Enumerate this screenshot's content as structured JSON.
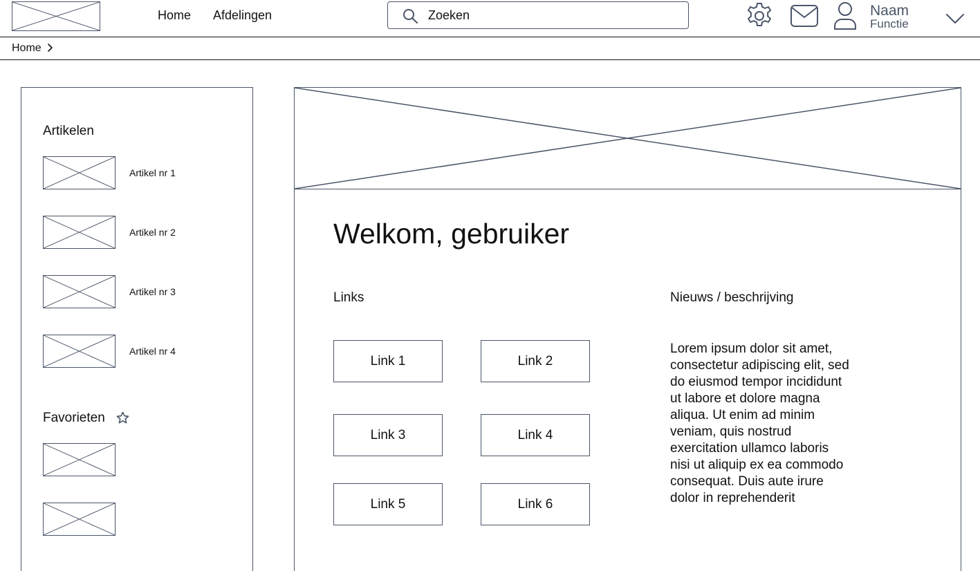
{
  "nav": {
    "home": "Home",
    "departments": "Afdelingen"
  },
  "search": {
    "placeholder": "Zoeken"
  },
  "user": {
    "name": "Naam",
    "role": "Functie"
  },
  "icons": {
    "search": "search-icon",
    "settings": "gear-icon",
    "mail": "mail-icon",
    "user": "user-icon",
    "dropdown": "chevron-down-icon",
    "favorite": "star-icon",
    "breadcrumb_separator": "chevron-right-icon"
  },
  "breadcrumb": {
    "items": [
      "Home"
    ]
  },
  "sidebar": {
    "articles_title": "Artikelen",
    "articles": [
      {
        "label": "Artikel nr 1"
      },
      {
        "label": "Artikel nr 2"
      },
      {
        "label": "Artikel nr 3"
      },
      {
        "label": "Artikel nr 4"
      }
    ],
    "favorites_title": "Favorieten"
  },
  "main": {
    "welcome": "Welkom, gebruiker",
    "links_title": "Links",
    "links": [
      {
        "label": "Link 1"
      },
      {
        "label": "Link 2"
      },
      {
        "label": "Link 3"
      },
      {
        "label": "Link 4"
      },
      {
        "label": "Link 5"
      },
      {
        "label": "Link 6"
      }
    ],
    "news_title": "Nieuws / beschrijving",
    "news_text": "Lorem ipsum dolor sit amet, consectetur adipiscing elit, sed do eiusmod tempor incididunt ut labore et dolore magna aliqua. Ut enim ad minim veniam, quis nostrud exercitation ullamco laboris nisi ut aliquip ex ea commodo consequat. Duis aute irure dolor in reprehenderit"
  },
  "colors": {
    "wireframe_stroke": "#4a5568",
    "text": "#111111",
    "background": "#ffffff"
  }
}
